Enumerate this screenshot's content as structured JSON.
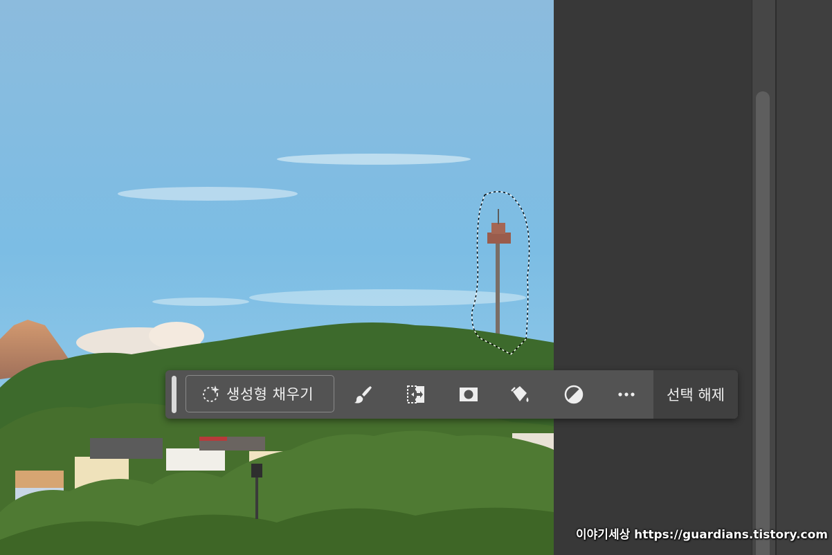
{
  "taskbar": {
    "generative_fill_label": "생성형 채우기",
    "deselect_label": "선택 해제",
    "tools": [
      {
        "icon": "brush-icon"
      },
      {
        "icon": "transform-selection-icon"
      },
      {
        "icon": "mask-icon"
      },
      {
        "icon": "fill-bucket-icon"
      },
      {
        "icon": "adjustment-icon"
      },
      {
        "icon": "more-icon"
      }
    ]
  },
  "watermark": {
    "text": "이야기세상 https://guardians.tistory.com"
  },
  "colors": {
    "panel_bg": "#383838",
    "taskbar_bg": "#535353",
    "deselect_bg": "#404040",
    "sky_top": "#86b8dd",
    "sky_bottom": "#7fc3ea",
    "foliage": "#3f6a2a"
  }
}
